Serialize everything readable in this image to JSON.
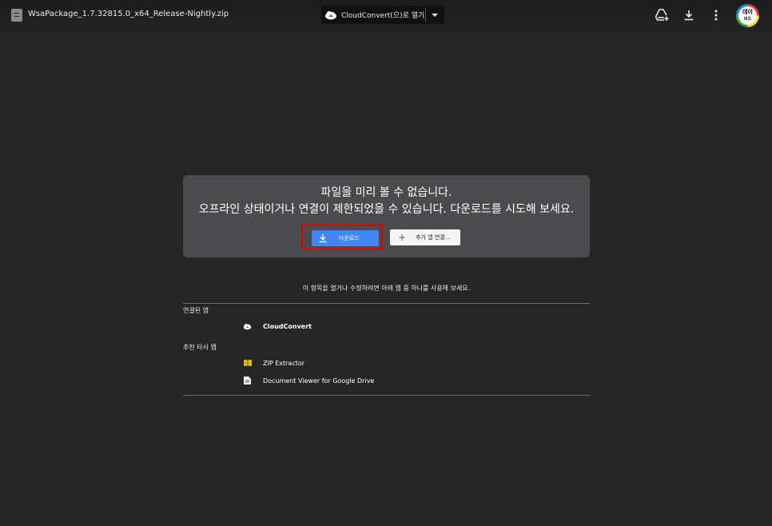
{
  "header": {
    "file_name": "WsaPackage_1.7.32815.0_x64_Release-Nightly.zip",
    "open_with_label": "CloudConvert(으)로 열기"
  },
  "avatar": {
    "text_line1": "데이",
    "text_line2": "비즈"
  },
  "preview": {
    "title": "파일을 미리 볼 수 없습니다.",
    "description": "오프라인 상태이거나 연결이 제한되었을 수 있습니다. 다운로드를 시도해 보세요.",
    "download_label": "다운로드",
    "connect_label": "추가 앱 연결..."
  },
  "apps": {
    "hint": "이 항목을 열거나 수정하려면 아래 앱 중 하나를 사용해 보세요.",
    "connected_heading": "연결된 앱",
    "connected": [
      {
        "label": "CloudConvert",
        "icon": "cloudconvert-icon"
      }
    ],
    "suggested_heading": "추천 타사 앱",
    "suggested": [
      {
        "label": "ZIP Extractor",
        "icon": "zip-extractor-icon"
      },
      {
        "label": "Document Viewer for Google Drive",
        "icon": "document-viewer-icon"
      }
    ]
  },
  "colors": {
    "background": "#262626",
    "card": "#4b4a4d",
    "primary_button": "#4285f4",
    "highlight": "#e00000"
  }
}
